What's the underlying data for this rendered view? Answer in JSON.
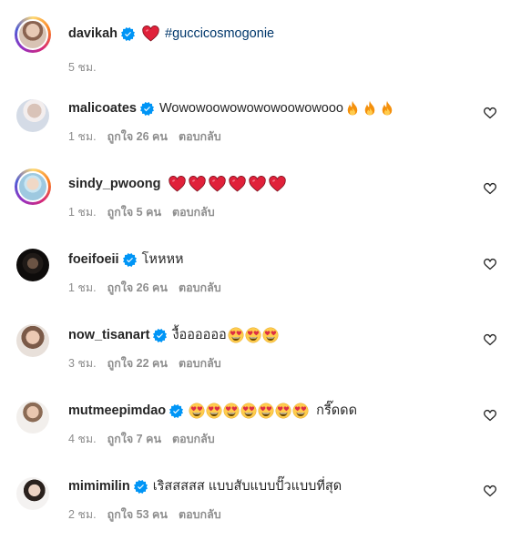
{
  "caption": {
    "username": "davikah",
    "hashtag": "#guccicosmogonie",
    "time": "5 ชม."
  },
  "comments": [
    {
      "username": "malicoates",
      "text": "Wowowoowowowowoowowooo",
      "emojis": [
        "fire-emoji",
        "fire-emoji",
        "fire-emoji"
      ],
      "time": "1 ชม.",
      "likes": "ถูกใจ 26 คน",
      "reply": "ตอบกลับ"
    },
    {
      "username": "sindy_pwoong",
      "text": "",
      "emojis": [
        "heart-emoji",
        "heart-emoji",
        "heart-emoji",
        "heart-emoji",
        "heart-emoji",
        "heart-emoji"
      ],
      "time": "1 ชม.",
      "likes": "ถูกใจ 5 คน",
      "reply": "ตอบกลับ"
    },
    {
      "username": "foeifoeii",
      "text": "โหหหห",
      "emojis": [],
      "time": "1 ชม.",
      "likes": "ถูกใจ 26 คน",
      "reply": "ตอบกลับ"
    },
    {
      "username": "now_tisanart",
      "text": "งื้ออออออ",
      "emojis": [
        "heart-eyes-emoji",
        "heart-eyes-emoji",
        "heart-eyes-emoji"
      ],
      "time": "3 ชม.",
      "likes": "ถูกใจ 22 คน",
      "reply": "ตอบกลับ"
    },
    {
      "username": "mutmeepimdao",
      "text": "",
      "emojis": [
        "heart-eyes-emoji",
        "heart-eyes-emoji",
        "heart-eyes-emoji",
        "heart-eyes-emoji",
        "heart-eyes-emoji",
        "heart-eyes-emoji",
        "heart-eyes-emoji"
      ],
      "text_after": "กรี๊ดดด",
      "time": "4 ชม.",
      "likes": "ถูกใจ 7 คน",
      "reply": "ตอบกลับ"
    },
    {
      "username": "mimimilin",
      "text": "เริสสสสส แบบสับแบบปั๊วแบบที่สุด",
      "emojis": [],
      "time": "2 ชม.",
      "likes": "ถูกใจ 53 คน",
      "reply": "ตอบกลับ"
    }
  ],
  "colors": {
    "verified": "#0095f6",
    "hashtag": "#00376b",
    "meta": "#8e8e8e",
    "heart": "#ed4956"
  }
}
